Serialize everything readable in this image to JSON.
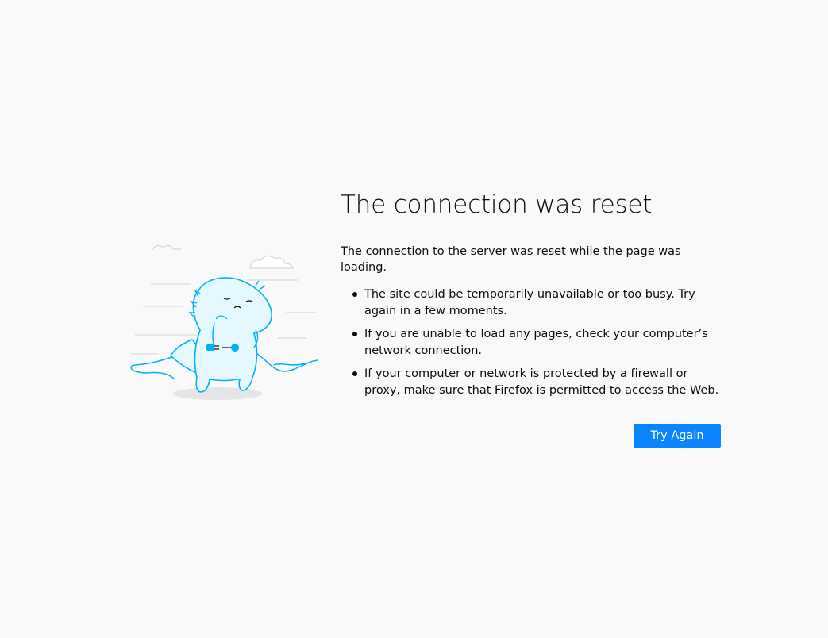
{
  "error": {
    "title": "The connection was reset",
    "intro": "The connection to the server was reset while the page was loading.",
    "bullets": [
      "The site could be temporarily unavailable or too busy. Try again in a few moments.",
      "If you are unable to load any pages, check your computer’s network connection.",
      "If your computer or network is protected by a firewall or proxy, make sure that Firefox is permitted to access the Web."
    ],
    "try_again_label": "Try Again"
  },
  "illustration": {
    "icon": "dino-unplugged-illustration",
    "stroke_color": "#00b3f4",
    "fill_color": "#e6f8ff"
  },
  "colors": {
    "background": "#f9f9fa",
    "button": "#0a84ff",
    "text": "#0c0c0d"
  }
}
